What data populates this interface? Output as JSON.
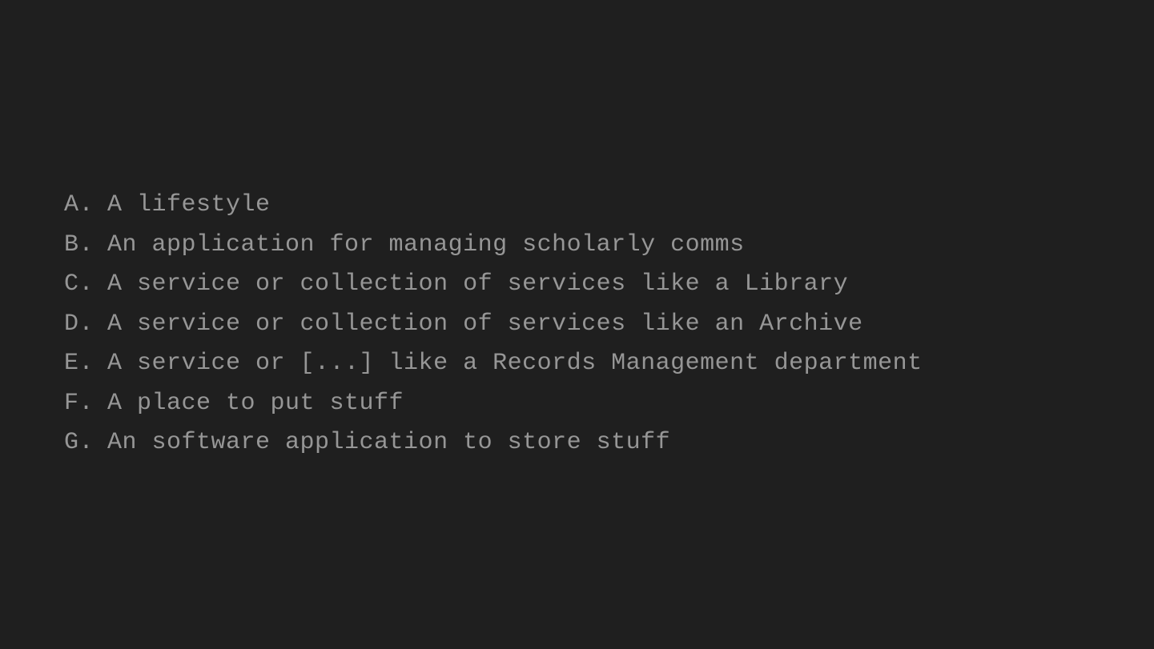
{
  "items": [
    {
      "marker": "A.",
      "text": "A lifestyle"
    },
    {
      "marker": "B.",
      "text": "An application for managing scholarly comms"
    },
    {
      "marker": "C.",
      "text": "A service or collection of services like a Library"
    },
    {
      "marker": "D.",
      "text": "A service or collection of services like an Archive"
    },
    {
      "marker": "E.",
      "text": "A service or [...] like a Records Management department"
    },
    {
      "marker": "F.",
      "text": "A place to put stuff"
    },
    {
      "marker": "G.",
      "text": "An software application to store stuff"
    }
  ]
}
